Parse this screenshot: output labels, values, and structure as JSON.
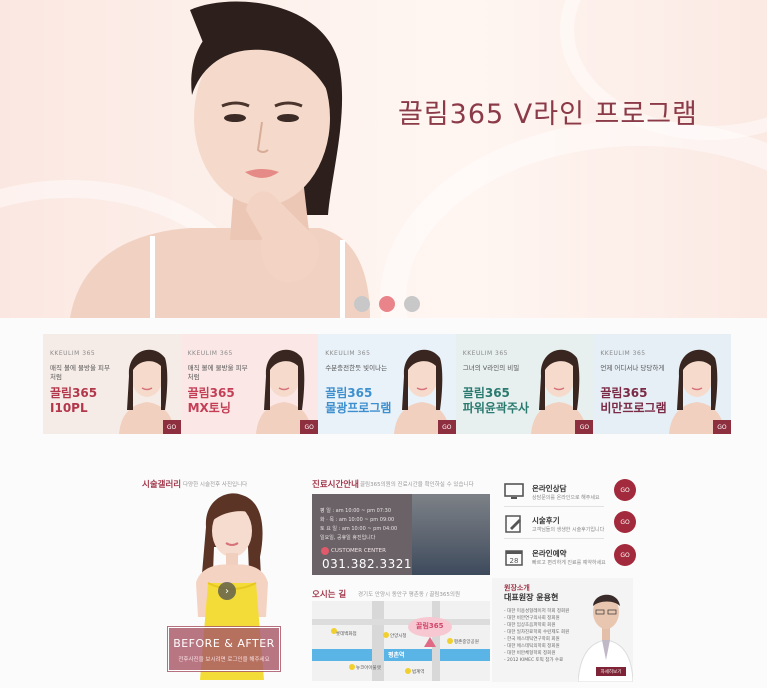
{
  "hero": {
    "title": "끌림365 V라인 프로그램",
    "slide_count": 3,
    "active_slide": 2
  },
  "cards": [
    {
      "brand": "KKEULIM 365",
      "sub": "매직 볼에 물방울 피부처럼",
      "name": "끌림365\nI10PL",
      "go": "GO",
      "bg": "#f6ece7",
      "name_color": "#b2374b"
    },
    {
      "brand": "KKEULIM 365",
      "sub": "매직 볼에 물방울 피부처럼",
      "name": "끌림365\nMX토닝",
      "go": "GO",
      "bg": "#fbe8e6",
      "name_color": "#c43f56"
    },
    {
      "brand": "KKEULIM 365",
      "sub": "수분충전한듯 빛이나는",
      "name": "끌림365\n물광프로그램",
      "go": "GO",
      "bg": "#e9f2f9",
      "name_color": "#3e8fce"
    },
    {
      "brand": "KKEULIM 365",
      "sub": "그녀의 V라인의 비밀",
      "name": "끌림365\n파워윤곽주사",
      "go": "GO",
      "bg": "#e7f0ef",
      "name_color": "#2a7a6f"
    },
    {
      "brand": "KKEULIM 365",
      "sub": "언제 어디서나 당당하게",
      "name": "끌림365\n비만프로그램",
      "go": "GO",
      "bg": "#e6eff6",
      "name_color": "#7a2a44"
    }
  ],
  "gallery": {
    "title": "시술갤러리",
    "subtitle": "다양한 시술전후 사진입니다",
    "ba_title": "BEFORE & AFTER",
    "ba_sub": "전후사진을 보시려면 로그인을 해주세요"
  },
  "hours": {
    "title": "진료시간안내",
    "subtitle": "끌림365의원의 진료시간을 확인하실 수 있습니다",
    "lines": [
      "평    일 : am 10:00 ~ pm 07:30",
      "화 · 목 : am 10:00 ~ pm 09:00",
      "토 요 일 : am 10:00 ~ pm 04:00",
      "일요일, 공휴일 휴진입니다"
    ],
    "cc_label": "CUSTOMER CENTER",
    "phone": "031.382.3321"
  },
  "directions": {
    "title": "오시는 길",
    "subtitle": "경기도 안양시 동안구 평촌동 / 끌림365의원",
    "map_logo": "끌림365",
    "map_labels": [
      "평촌역",
      "안양시청",
      "롯데백화점",
      "평촌중앙공원",
      "뉴코아아울렛",
      "범계역"
    ]
  },
  "services": [
    {
      "title": "온라인상담",
      "desc": "상담문의를 온라인으로 해주세요",
      "go": "GO",
      "icon": "monitor-icon"
    },
    {
      "title": "시술후기",
      "desc": "고객님들의 생생한 시술후기입니다",
      "go": "GO",
      "icon": "pencil-note-icon"
    },
    {
      "title": "온라인예약",
      "desc": "빠르고 편리하게 진료를 예약하세요",
      "go": "GO",
      "icon": "calendar-icon"
    }
  ],
  "calendar_day": "28",
  "director": {
    "label": "원장소개",
    "name": "대표원장 윤용현",
    "career": [
      "- 대한 미용성형레이저 학회 정회원",
      "- 대한 비만연구의사회 정회원",
      "- 대한 임상초음파학회 회원",
      "- 대한 일차진료학회 수련제도 회원",
      "- 한국 에스테틱연구학회 회원",
      "- 대한 에스테틱의학회 정회원",
      "- 대한 비만체형학회 정회원",
      "- 2012 KIMEC 토픽 참가 수료"
    ],
    "more": "자세히보기"
  },
  "colors": {
    "accent": "#a32a3c",
    "hero_title": "#8b3a48",
    "dot_active": "#e9848b",
    "dot_inactive": "#c8c8c8"
  }
}
